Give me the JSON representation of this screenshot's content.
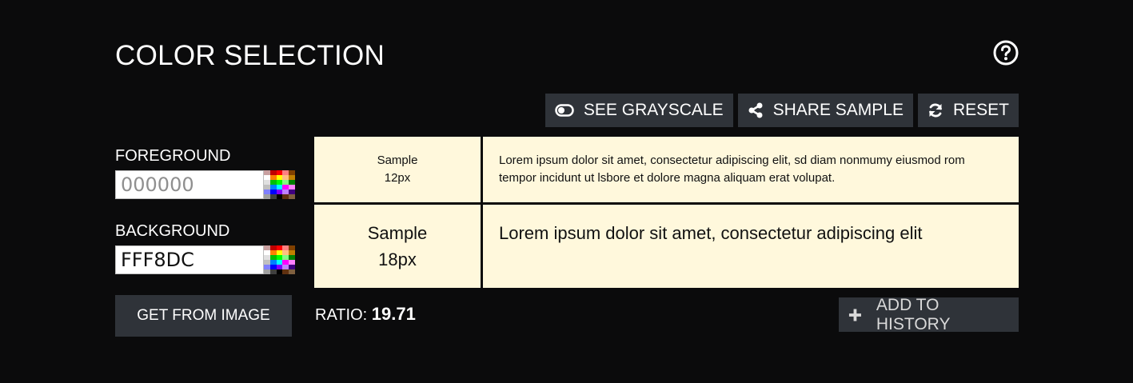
{
  "header": {
    "title": "COLOR SELECTION",
    "help_icon": "question-circle-icon"
  },
  "toolbar": {
    "grayscale_label": "SEE GRAYSCALE",
    "grayscale_icon": "toggle-icon",
    "share_label": "SHARE SAMPLE",
    "share_icon": "share-icon",
    "reset_label": "RESET",
    "reset_icon": "refresh-icon"
  },
  "foreground": {
    "label": "FOREGROUND",
    "value": "",
    "placeholder": "000000",
    "palette_icon": "color-palette-icon"
  },
  "background": {
    "label": "BACKGROUND",
    "value": "FFF8DC",
    "placeholder": "",
    "palette_icon": "color-palette-icon"
  },
  "get_from_image_label": "GET FROM IMAGE",
  "samples": {
    "small_label_line1": "Sample",
    "small_label_line2": "12px",
    "small_text": "Lorem ipsum dolor sit amet, consectetur adipiscing elit, sd diam nonmumy eiusmod rom tempor incidunt ut lsbore et dolore magna aliquam erat volupat.",
    "large_label_line1": "Sample",
    "large_label_line2": "18px",
    "large_text": "Lorem ipsum dolor sit amet, consectetur adipiscing elit"
  },
  "ratio": {
    "label": "RATIO:",
    "value": "19.71"
  },
  "history": {
    "label": "ADD TO HISTORY",
    "icon": "plus-icon"
  },
  "colors": {
    "page_background": "#0b0b0c",
    "button_background": "#2f3339",
    "sample_background": "#FFF8DC",
    "sample_foreground": "#000000"
  },
  "palette_colors": [
    "#c9a0a0",
    "#c00000",
    "#ff0000",
    "#ff8080",
    "#804000",
    "#ffffff",
    "#ff8000",
    "#ffff00",
    "#ffc080",
    "#c08000",
    "#e0e0e0",
    "#00c000",
    "#00ff00",
    "#80ff80",
    "#008000",
    "#c0c0c0",
    "#0080ff",
    "#00ffff",
    "#ff00ff",
    "#ff80ff",
    "#8080ff",
    "#0000ff",
    "#8000ff",
    "#c080ff",
    "#400080",
    "#a0a0a0",
    "#404040",
    "#000000",
    "#603010",
    "#806040"
  ]
}
